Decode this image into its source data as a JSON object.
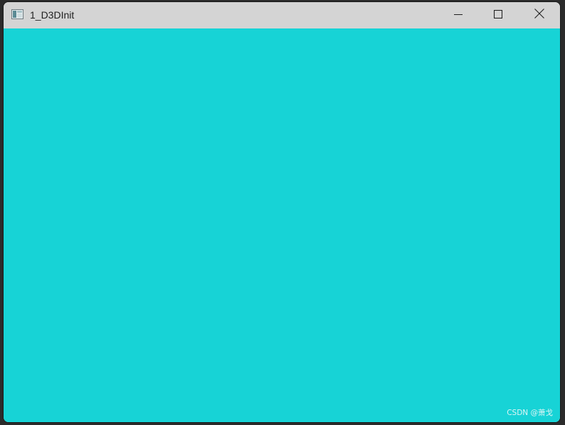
{
  "window": {
    "title": "1_D3DInit",
    "client_color": "#17d3d6",
    "titlebar_color": "#d4d4d4"
  },
  "icons": {
    "app": "app-window-icon",
    "minimize": "minimize-icon",
    "maximize": "maximize-icon",
    "close": "close-icon"
  },
  "watermark": {
    "text": "CSDN @萧戈"
  }
}
